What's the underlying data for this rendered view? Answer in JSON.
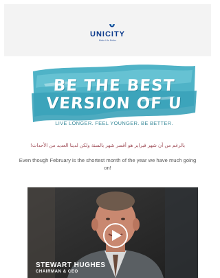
{
  "header": {
    "brand": "UNICITY",
    "tagline": "Make Life Better",
    "logo_icon": "unicity-swirl-icon",
    "background": "#f3f3f3",
    "brand_color": "#0b3a8c"
  },
  "banner": {
    "line1": "BE THE BEST",
    "line2": "VERSION OF U",
    "subline": "LIVE LONGER. FEEL YOUNGER. BE BETTER.",
    "brush_color": "#4fb3c7"
  },
  "body": {
    "arabic": "بالرغم من أن شهر فبراير هو أقصر شهر بالسنة ولكن لدينا العديد من الأحداث!",
    "intro": "Even though February is the shortest month of the year we have much going on!"
  },
  "video": {
    "name": "STEWART HUGHES",
    "title": "CHAIRMAN & CEO",
    "play_icon": "play-icon"
  }
}
